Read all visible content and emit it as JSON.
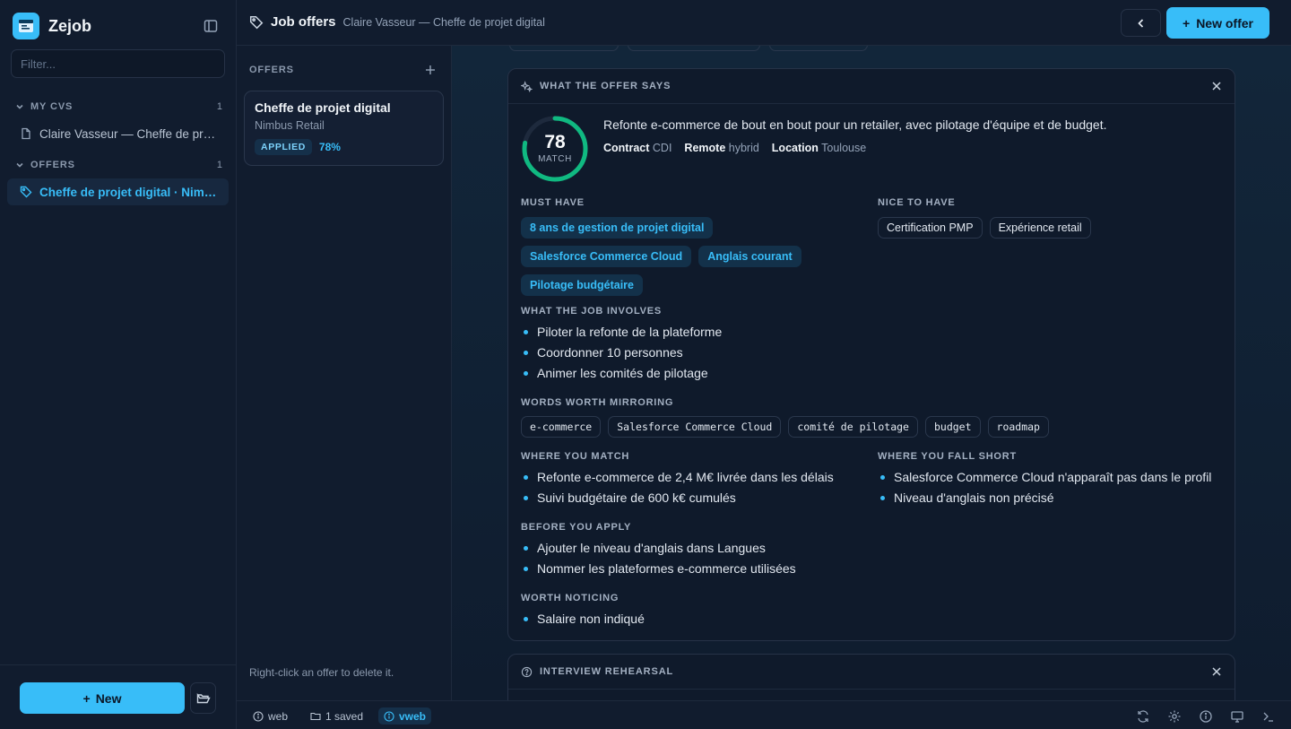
{
  "app": {
    "name": "Zejob"
  },
  "sidebar": {
    "filter_placeholder": "Filter...",
    "sections": [
      {
        "title": "MY CVS",
        "count": "1",
        "items": [
          {
            "label": "Claire Vasseur — Cheffe de projet digital",
            "icon": "document-icon"
          }
        ]
      },
      {
        "title": "OFFERS",
        "count": "1",
        "items": [
          {
            "label": "Cheffe de projet digital · Nimbus Retail",
            "icon": "tag-icon",
            "active": true
          }
        ]
      }
    ],
    "new_label": "New"
  },
  "header": {
    "title": "Job offers",
    "subtitle": "Claire Vasseur — Cheffe de projet digital",
    "new_offer_label": "New offer"
  },
  "offers": {
    "heading": "OFFERS",
    "items": [
      {
        "title": "Cheffe de projet digital",
        "company": "Nimbus Retail",
        "status": "APPLIED",
        "match": "78%"
      }
    ],
    "hint": "Right-click an offer to delete it."
  },
  "analysis": {
    "heading": "WHAT THE OFFER SAYS",
    "score": 78,
    "score_label": "MATCH",
    "summary": "Refonte e-commerce de bout en bout pour un retailer, avec pilotage d'équipe et de budget.",
    "facts": [
      {
        "label": "Contract",
        "value": "CDI"
      },
      {
        "label": "Remote",
        "value": "hybrid"
      },
      {
        "label": "Location",
        "value": "Toulouse"
      }
    ],
    "must_have_label": "MUST HAVE",
    "must_have": [
      "8 ans de gestion de projet digital",
      "Salesforce Commerce Cloud",
      "Anglais courant",
      "Pilotage budgétaire"
    ],
    "nice_to_have_label": "NICE TO HAVE",
    "nice_to_have": [
      "Certification PMP",
      "Expérience retail"
    ],
    "involves_label": "WHAT THE JOB INVOLVES",
    "involves": [
      "Piloter la refonte de la plateforme",
      "Coordonner 10 personnes",
      "Animer les comités de pilotage"
    ],
    "mirror_label": "WORDS WORTH MIRRORING",
    "mirror": [
      "e-commerce",
      "Salesforce Commerce Cloud",
      "comité de pilotage",
      "budget",
      "roadmap"
    ],
    "match_label": "WHERE YOU MATCH",
    "match": [
      "Refonte e-commerce de 2,4 M€ livrée dans les délais",
      "Suivi budgétaire de 600 k€ cumulés"
    ],
    "short_label": "WHERE YOU FALL SHORT",
    "short": [
      "Salesforce Commerce Cloud n'apparaît pas dans le profil",
      "Niveau d'anglais non précisé"
    ],
    "before_label": "BEFORE YOU APPLY",
    "before": [
      "Ajouter le niveau d'anglais dans Langues",
      "Nommer les plateformes e-commerce utilisées"
    ],
    "noticing_label": "WORTH NOTICING",
    "noticing": [
      "Salaire non indiqué"
    ]
  },
  "rehearsal": {
    "heading": "INTERVIEW REHEARSAL"
  },
  "statusbar": {
    "items": [
      {
        "label": "web",
        "icon": "info-icon"
      },
      {
        "label": "1 saved",
        "icon": "folder-icon"
      },
      {
        "label": "vweb",
        "icon": "info-icon",
        "active": true
      }
    ],
    "right_icons": [
      "refresh-icon",
      "settings-icon",
      "info-icon",
      "monitor-icon",
      "terminal-icon"
    ]
  },
  "colors": {
    "accent": "#38bdf8",
    "gauge": "#10b981",
    "background": "#0f1a2b"
  }
}
